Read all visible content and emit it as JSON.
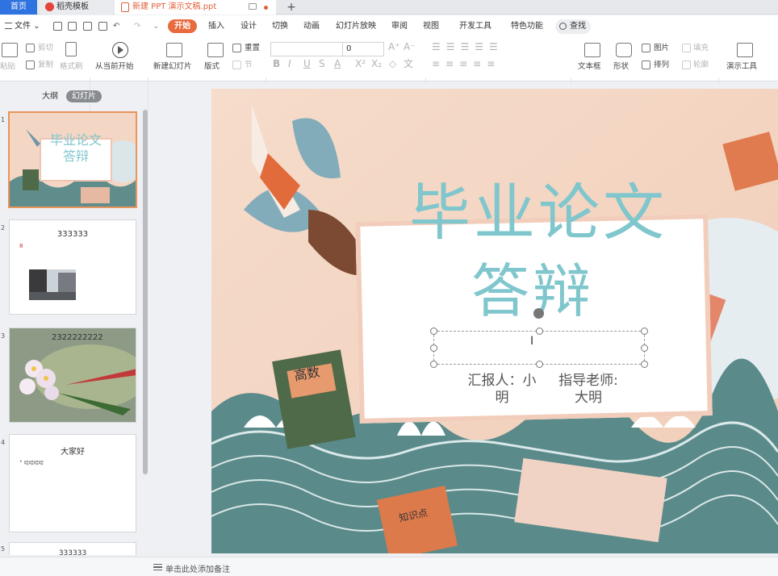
{
  "tabs": {
    "home": "首页",
    "template": "稻壳模板",
    "document": "新建 PPT 演示文稿.ppt",
    "add": "+"
  },
  "menu": {
    "file": "文件",
    "items": [
      "开始",
      "插入",
      "设计",
      "切换",
      "动画",
      "幻灯片放映",
      "审阅",
      "视图",
      "开发工具",
      "特色功能"
    ],
    "search": "查找"
  },
  "ribbon": {
    "paste": "粘贴",
    "cut": "剪切",
    "copy": "复制",
    "format_painter": "格式刷",
    "play_from_current": "从当前开始",
    "new_slide": "新建幻灯片",
    "layout": "版式",
    "reset": "重置",
    "section": "节",
    "font_name": "",
    "font_size": "0",
    "text_box": "文本框",
    "shape": "形状",
    "picture": "图片",
    "fill": "填充",
    "arrange": "排列",
    "outline": "轮廓",
    "presentation_tools": "演示工具"
  },
  "panel": {
    "outline_tab": "大纲",
    "slides_tab": "幻灯片",
    "thumbs": [
      {
        "num": "1",
        "title": "毕业论文",
        "subtitle": "答辩"
      },
      {
        "num": "2",
        "title": "333333",
        "bullet": "8"
      },
      {
        "num": "3",
        "title": "2322222222"
      },
      {
        "num": "4",
        "title": "大家好",
        "bullet": "哈哈哈哈"
      },
      {
        "num": "5",
        "title": "333333"
      }
    ],
    "add_slide": "+"
  },
  "slide": {
    "title_line1": "毕业论文",
    "title_line2": "答辩",
    "reporter_line1": "汇报人：小",
    "reporter_line2": "明",
    "advisor_line1": "指导老师:",
    "advisor_line2": "大明",
    "book_green_label": "高数",
    "book_orange_label": "知识点"
  },
  "notes": {
    "placeholder": "单击此处添加备注"
  },
  "colors": {
    "accent_orange": "#e86a3d",
    "tab_blue": "#2f73e0",
    "title_teal": "#7fc6cd",
    "slide_bg": "#f4d9c8"
  }
}
